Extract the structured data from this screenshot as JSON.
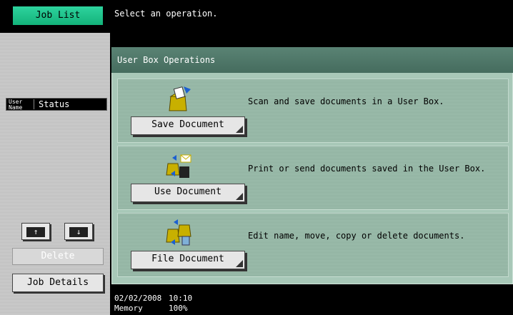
{
  "header": {
    "job_list_label": "Job List",
    "message": "Select an operation."
  },
  "queue": {
    "user_name_label": "User Name",
    "user_name_line1": "User",
    "user_name_line2": "Name",
    "status_label": "Status"
  },
  "left_controls": {
    "up_icon": "up-arrow-icon",
    "up_glyph": "↑",
    "down_icon": "down-arrow-icon",
    "down_glyph": "↓",
    "delete_label": "Delete",
    "job_details_label": "Job Details"
  },
  "panel": {
    "title": "User Box Operations",
    "operations": [
      {
        "button_label": "Save Document",
        "description": "Scan and save documents in a User Box.",
        "icon": "save-document-icon"
      },
      {
        "button_label": "Use Document",
        "description": "Print or send documents saved in the User Box.",
        "icon": "use-document-icon"
      },
      {
        "button_label": "File Document",
        "description": "Edit name, move, copy or delete documents.",
        "icon": "file-document-icon"
      }
    ]
  },
  "status_bar": {
    "date": "02/02/2008",
    "time": "10:10",
    "memory_label": "Memory",
    "memory_value": "100%"
  },
  "colors": {
    "accent_green": "#13b37a",
    "panel_bg": "#a8c8b8",
    "title_bar": "#4f7768"
  }
}
